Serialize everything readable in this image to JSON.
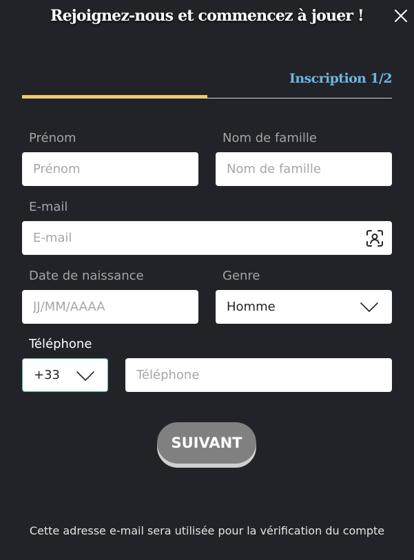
{
  "header": {
    "title": "Rejoignez-nous et commencez à jouer !",
    "step_label": "Inscription 1/2",
    "progress_fraction": 0.5
  },
  "form": {
    "first_name": {
      "label": "Prénom",
      "placeholder": "Prénom"
    },
    "last_name": {
      "label": "Nom de famille",
      "placeholder": "Nom de famille"
    },
    "email": {
      "label": "E-mail",
      "placeholder": "E-mail"
    },
    "birth_date": {
      "label": "Date de naissance",
      "placeholder": "JJ/MM/AAAA"
    },
    "gender": {
      "label": "Genre",
      "value": "Homme"
    },
    "phone": {
      "label": "Téléphone",
      "country_code": "+33",
      "placeholder": "Téléphone"
    }
  },
  "next_button": {
    "label": "SUIVANT"
  },
  "footer": {
    "note": "Cette adresse e-mail sera utilisée pour la vérification du compte"
  },
  "colors": {
    "background": "#222328",
    "accent_yellow": "#f5c85a",
    "step_blue": "#6cb6dc",
    "button_gray": "#808080"
  },
  "icons": {
    "close": "close-icon",
    "email_contact": "contact-icon",
    "gender_dropdown": "chevron-down-icon",
    "phone_code_dropdown": "chevron-down-icon"
  }
}
